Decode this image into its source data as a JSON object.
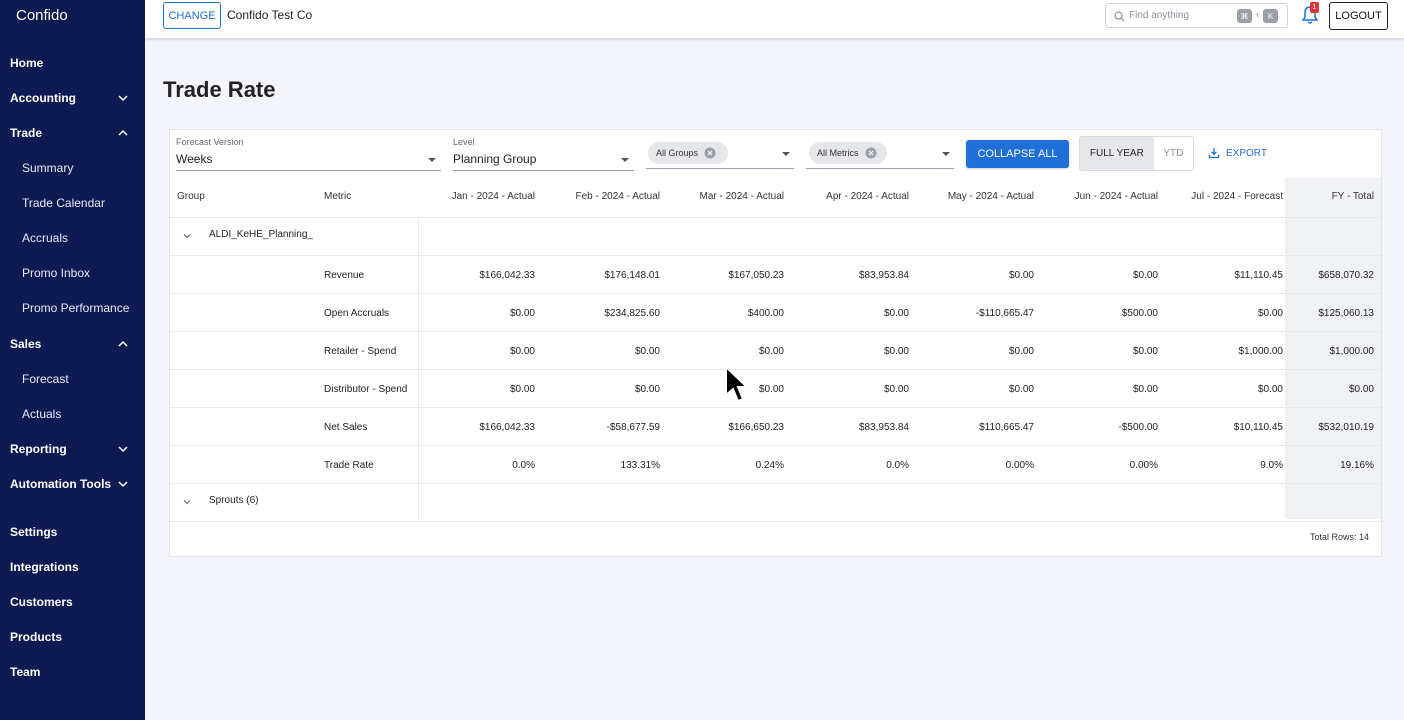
{
  "brand": "Confido",
  "sidebar": {
    "items": [
      {
        "label": "Home",
        "type": "top",
        "chevron": ""
      },
      {
        "label": "Accounting",
        "type": "top",
        "chevron": "down"
      },
      {
        "label": "Trade",
        "type": "top",
        "chevron": "up"
      },
      {
        "label": "Summary",
        "type": "sub",
        "chevron": ""
      },
      {
        "label": "Trade Calendar",
        "type": "sub",
        "chevron": ""
      },
      {
        "label": "Accruals",
        "type": "sub",
        "chevron": ""
      },
      {
        "label": "Promo Inbox",
        "type": "sub",
        "chevron": ""
      },
      {
        "label": "Promo Performance",
        "type": "sub",
        "chevron": ""
      },
      {
        "label": "Sales",
        "type": "top",
        "chevron": "up"
      },
      {
        "label": "Forecast",
        "type": "sub",
        "chevron": ""
      },
      {
        "label": "Actuals",
        "type": "sub",
        "chevron": ""
      },
      {
        "label": "Reporting",
        "type": "top",
        "chevron": "down"
      },
      {
        "label": "Automation Tools",
        "type": "top",
        "chevron": "down"
      },
      {
        "label": "Settings",
        "type": "top",
        "chevron": ""
      },
      {
        "label": "Integrations",
        "type": "top",
        "chevron": ""
      },
      {
        "label": "Customers",
        "type": "top",
        "chevron": ""
      },
      {
        "label": "Products",
        "type": "top",
        "chevron": ""
      },
      {
        "label": "Team",
        "type": "top",
        "chevron": ""
      }
    ]
  },
  "topbar": {
    "change_label": "CHANGE",
    "company": "Confido Test Co",
    "search_placeholder": "Find anything",
    "kbd_cmd": "⌘",
    "kbd_plus": "+",
    "kbd_k": "K",
    "notification_count": "1",
    "logout_label": "LOGOUT"
  },
  "page": {
    "title": "Trade Rate"
  },
  "filters": {
    "forecast_version_label": "Forecast Version",
    "forecast_version_value": "Weeks",
    "level_label": "Level",
    "level_value": "Planning Group",
    "groups_chip": "All Groups",
    "metrics_chip": "All Metrics",
    "collapse_label": "COLLAPSE ALL",
    "full_year_label": "FULL YEAR",
    "ytd_label": "YTD",
    "export_label": "EXPORT"
  },
  "table": {
    "headers": {
      "group": "Group",
      "metric": "Metric",
      "months": [
        "Jan - 2024 - Actual",
        "Feb - 2024 - Actual",
        "Mar - 2024 - Actual",
        "Apr - 2024 - Actual",
        "May - 2024 - Actual",
        "Jun - 2024 - Actual",
        "Jul - 2024 - Forecast"
      ],
      "total": "FY - Total"
    },
    "groups": [
      {
        "name": "ALDI_KeHE_Planning_",
        "rows": [
          {
            "metric": "Revenue",
            "values": [
              "$166,042.33",
              "$176,148.01",
              "$167,050.23",
              "$83,953.84",
              "$0.00",
              "$0.00",
              "$11,110.45"
            ],
            "total": "$658,070.32"
          },
          {
            "metric": "Open Accruals",
            "values": [
              "$0.00",
              "$234,825.60",
              "$400.00",
              "$0.00",
              "-$110,665.47",
              "$500.00",
              "$0.00"
            ],
            "total": "$125,060.13"
          },
          {
            "metric": "Retailer - Spend",
            "values": [
              "$0.00",
              "$0.00",
              "$0.00",
              "$0.00",
              "$0.00",
              "$0.00",
              "$1,000.00"
            ],
            "total": "$1,000.00"
          },
          {
            "metric": "Distributor - Spend",
            "values": [
              "$0.00",
              "$0.00",
              "$0.00",
              "$0.00",
              "$0.00",
              "$0.00",
              "$0.00"
            ],
            "total": "$0.00"
          },
          {
            "metric": "Net Sales",
            "values": [
              "$166,042.33",
              "-$58,677.59",
              "$166,650.23",
              "$83,953.84",
              "$110,665.47",
              "-$500.00",
              "$10,110.45"
            ],
            "total": "$532,010.19"
          },
          {
            "metric": "Trade Rate",
            "values": [
              "0.0%",
              "133.31%",
              "0.24%",
              "0.0%",
              "0.00%",
              "0.00%",
              "9.0%"
            ],
            "total": "19.16%"
          }
        ]
      },
      {
        "name": "Sprouts (6)",
        "rows": []
      }
    ],
    "total_rows": "Total Rows: 14"
  },
  "colors": {
    "sidebar_bg": "#0e1a52",
    "accent": "#1f6fd6",
    "badge": "#d93838"
  }
}
